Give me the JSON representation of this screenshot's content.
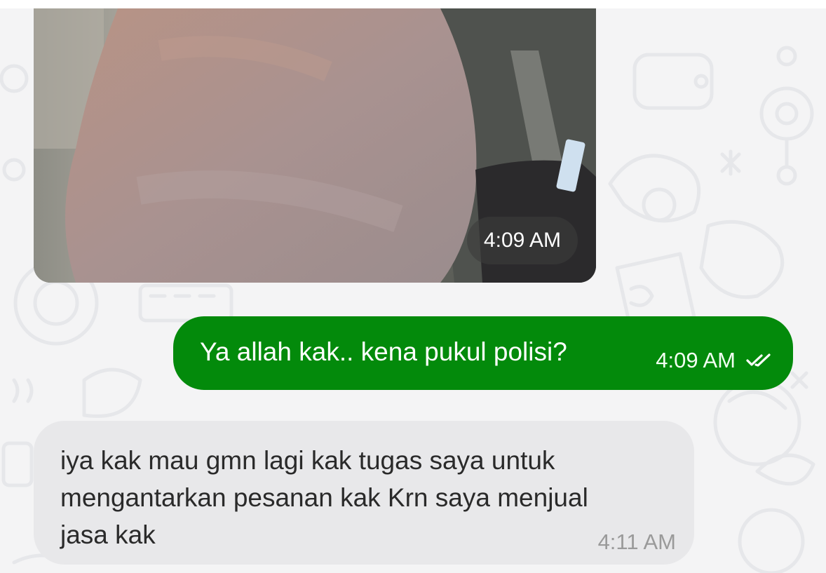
{
  "colors": {
    "chat_background": "#f4f4f5",
    "outgoing_bubble": "#038a0b",
    "incoming_bubble": "#e8e8ea",
    "timestamp_overlay": "#3c3c3c"
  },
  "messages": [
    {
      "type": "image",
      "direction": "incoming",
      "time": "4:09 AM"
    },
    {
      "type": "text",
      "direction": "outgoing",
      "text": "Ya allah kak.. kena pukul polisi?",
      "time": "4:09 AM",
      "status_icon": "double-check-icon"
    },
    {
      "type": "text",
      "direction": "incoming",
      "text": "iya kak mau gmn lagi kak tugas saya untuk mengantarkan pesanan kak Krn saya menjual jasa kak",
      "time": "4:11 AM"
    }
  ]
}
